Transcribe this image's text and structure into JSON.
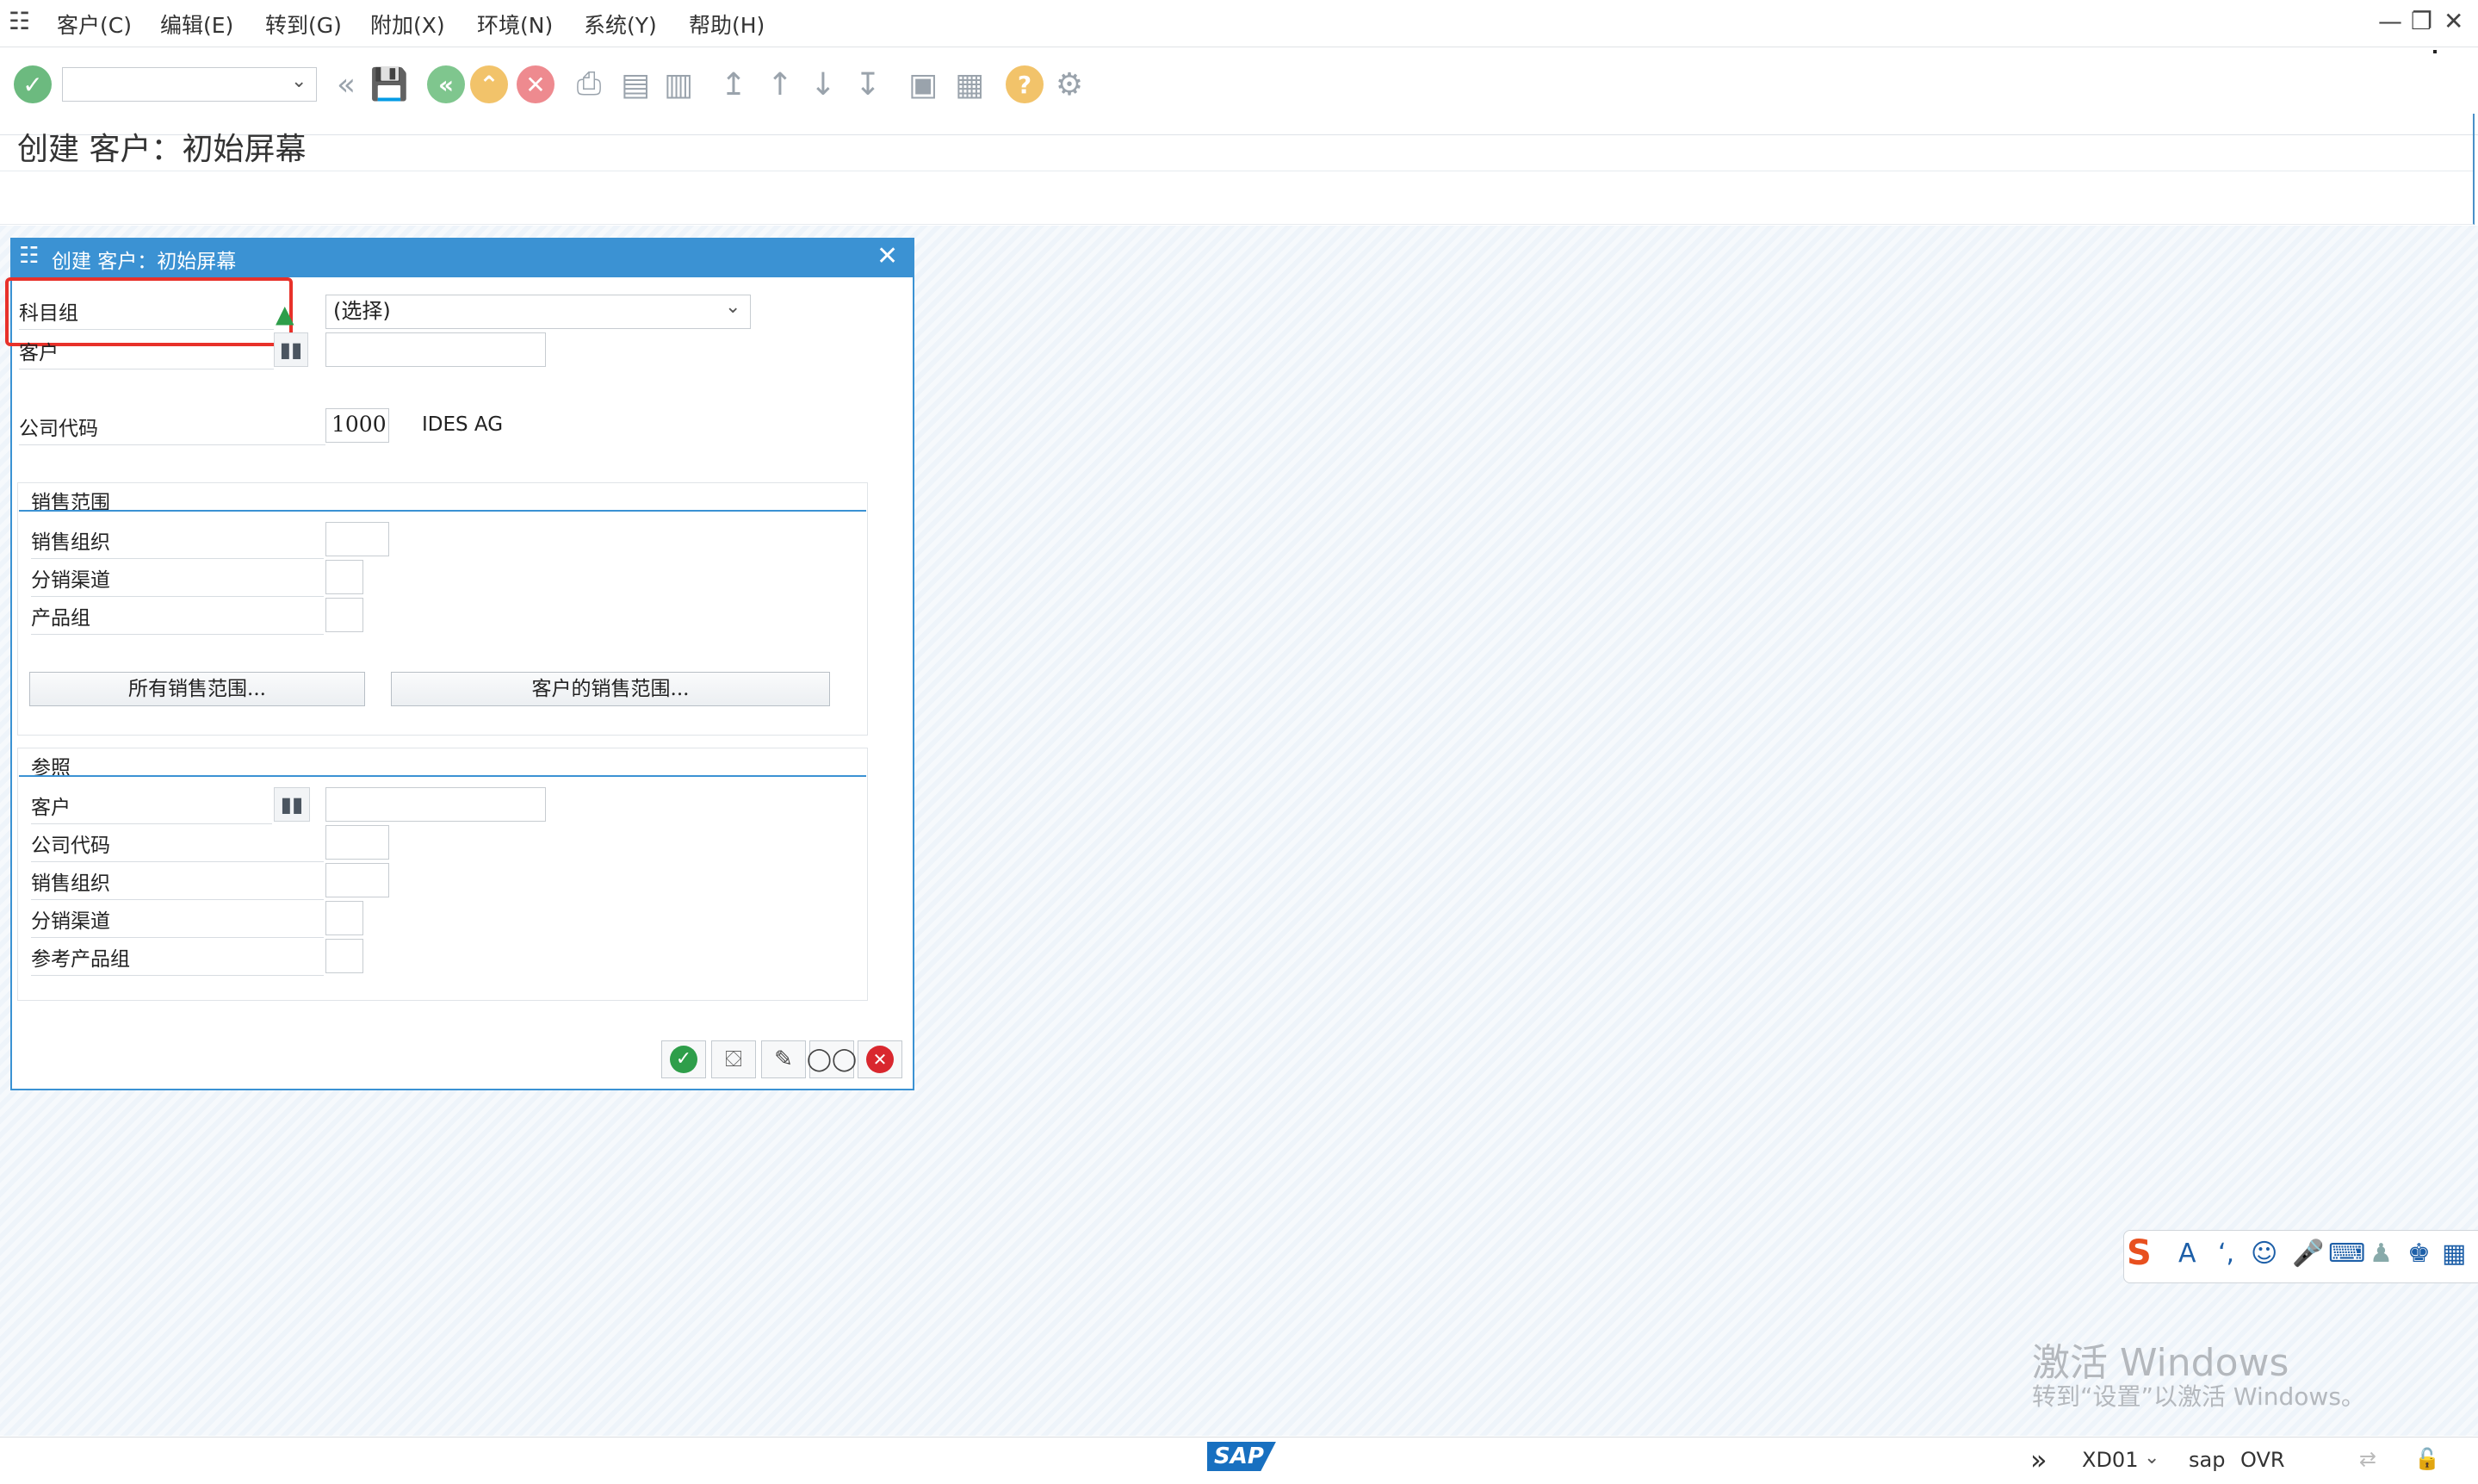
{
  "menu": {
    "items": [
      "客户(C)",
      "编辑(E)",
      "转到(G)",
      "附加(X)",
      "环境(N)",
      "系统(Y)",
      "帮助(H)"
    ]
  },
  "window_controls": {
    "minimize": "—",
    "restore": "❐",
    "close": "✕"
  },
  "toolbar": {
    "command_field": "",
    "icons": [
      "enter-icon",
      "back-double-icon",
      "save-icon",
      "back-icon",
      "exit-icon",
      "cancel-icon",
      "print-icon",
      "find-icon",
      "find-next-icon",
      "first-page-icon",
      "previous-page-icon",
      "next-page-icon",
      "last-page-icon",
      "new-session-icon",
      "shortcut-icon",
      "help-icon",
      "settings-icon"
    ]
  },
  "screen": {
    "title": "创建 客户：初始屏幕"
  },
  "dialog": {
    "title": "创建 客户：初始屏幕",
    "account_group": {
      "label": "科目组",
      "value": "(选择)"
    },
    "customer": {
      "label": "客户",
      "value": ""
    },
    "company_code": {
      "label": "公司代码",
      "value": "1000",
      "description": "IDES AG"
    },
    "sales_area": {
      "title": "销售范围",
      "sales_org": {
        "label": "销售组织",
        "value": ""
      },
      "distribution_channel": {
        "label": "分销渠道",
        "value": ""
      },
      "division": {
        "label": "产品组",
        "value": ""
      },
      "all_sales_areas_button": "所有销售范围...",
      "customer_sales_areas_button": "客户的销售范围..."
    },
    "reference": {
      "title": "参照",
      "customer": {
        "label": "客户",
        "value": ""
      },
      "company_code": {
        "label": "公司代码",
        "value": ""
      },
      "sales_org": {
        "label": "销售组织",
        "value": ""
      },
      "distribution_channel": {
        "label": "分销渠道",
        "value": ""
      },
      "division": {
        "label": "参考产品组",
        "value": ""
      }
    },
    "footer_icons": [
      "check-icon",
      "transport-icon",
      "edit-icon",
      "display-icon",
      "cancel-icon"
    ]
  },
  "statusbar": {
    "logo": "SAP",
    "transaction": "XD01",
    "system": "sap",
    "mode": "OVR"
  },
  "watermark": {
    "line1": "激活 Windows",
    "line2": "转到“设置”以激活 Windows。"
  },
  "colors": {
    "accent": "#3b92d3",
    "highlight": "#e8312a",
    "ok_green": "#2e9e4a",
    "cancel_red": "#d9272e",
    "warn_orange": "#f0a020"
  }
}
